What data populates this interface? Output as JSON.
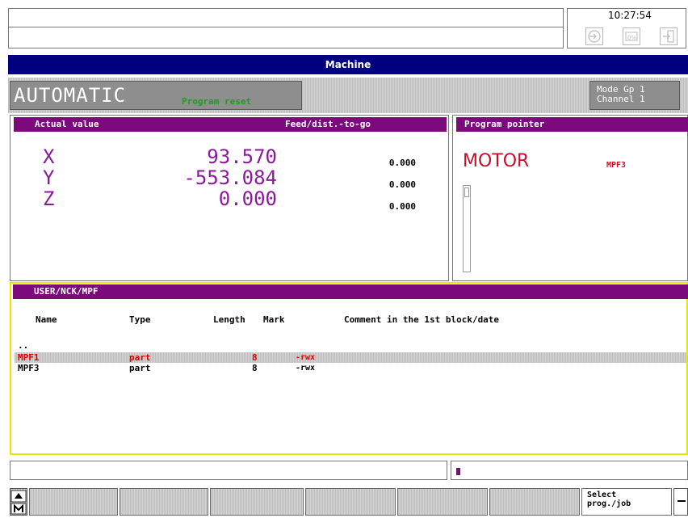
{
  "header": {
    "clock": "10:27:54",
    "title": "Machine"
  },
  "mode": {
    "label": "AUTOMATIC",
    "status": "Program reset",
    "group_line1": "Mode Gp 1",
    "group_line2": "Channel 1"
  },
  "actual_value": {
    "title": "Actual value",
    "feed_title": "Feed/dist.-to-go",
    "axes": [
      {
        "name": "X",
        "value": "93.570",
        "dist": "0.000"
      },
      {
        "name": "Y",
        "value": "-553.084",
        "dist": "0.000"
      },
      {
        "name": "Z",
        "value": "0.000",
        "dist": "0.000"
      }
    ]
  },
  "program_pointer": {
    "title": "Program pointer",
    "program": "MOTOR",
    "file": "MPF3"
  },
  "directory": {
    "path": "USER/NCK/MPF",
    "columns": {
      "name": "Name",
      "type": "Type",
      "length": "Length",
      "mark": "Mark",
      "comment": "Comment in the 1st block/date"
    },
    "parent": "..",
    "rows": [
      {
        "name": "MPF1",
        "type": "part",
        "length": "8",
        "mark": "-rwx"
      },
      {
        "name": "MPF3",
        "type": "part",
        "length": "8",
        "mark": "-rwx"
      }
    ]
  },
  "softkeys": {
    "select_line1": "Select",
    "select_line2": "prog./job"
  },
  "colors": {
    "title_bar": "#000080",
    "panel_header": "#7b0a7b",
    "mode_status": "#1c9e1c",
    "selected_row_text": "#e00000",
    "values": "#8a1a9a",
    "active_border": "#e6e600"
  }
}
